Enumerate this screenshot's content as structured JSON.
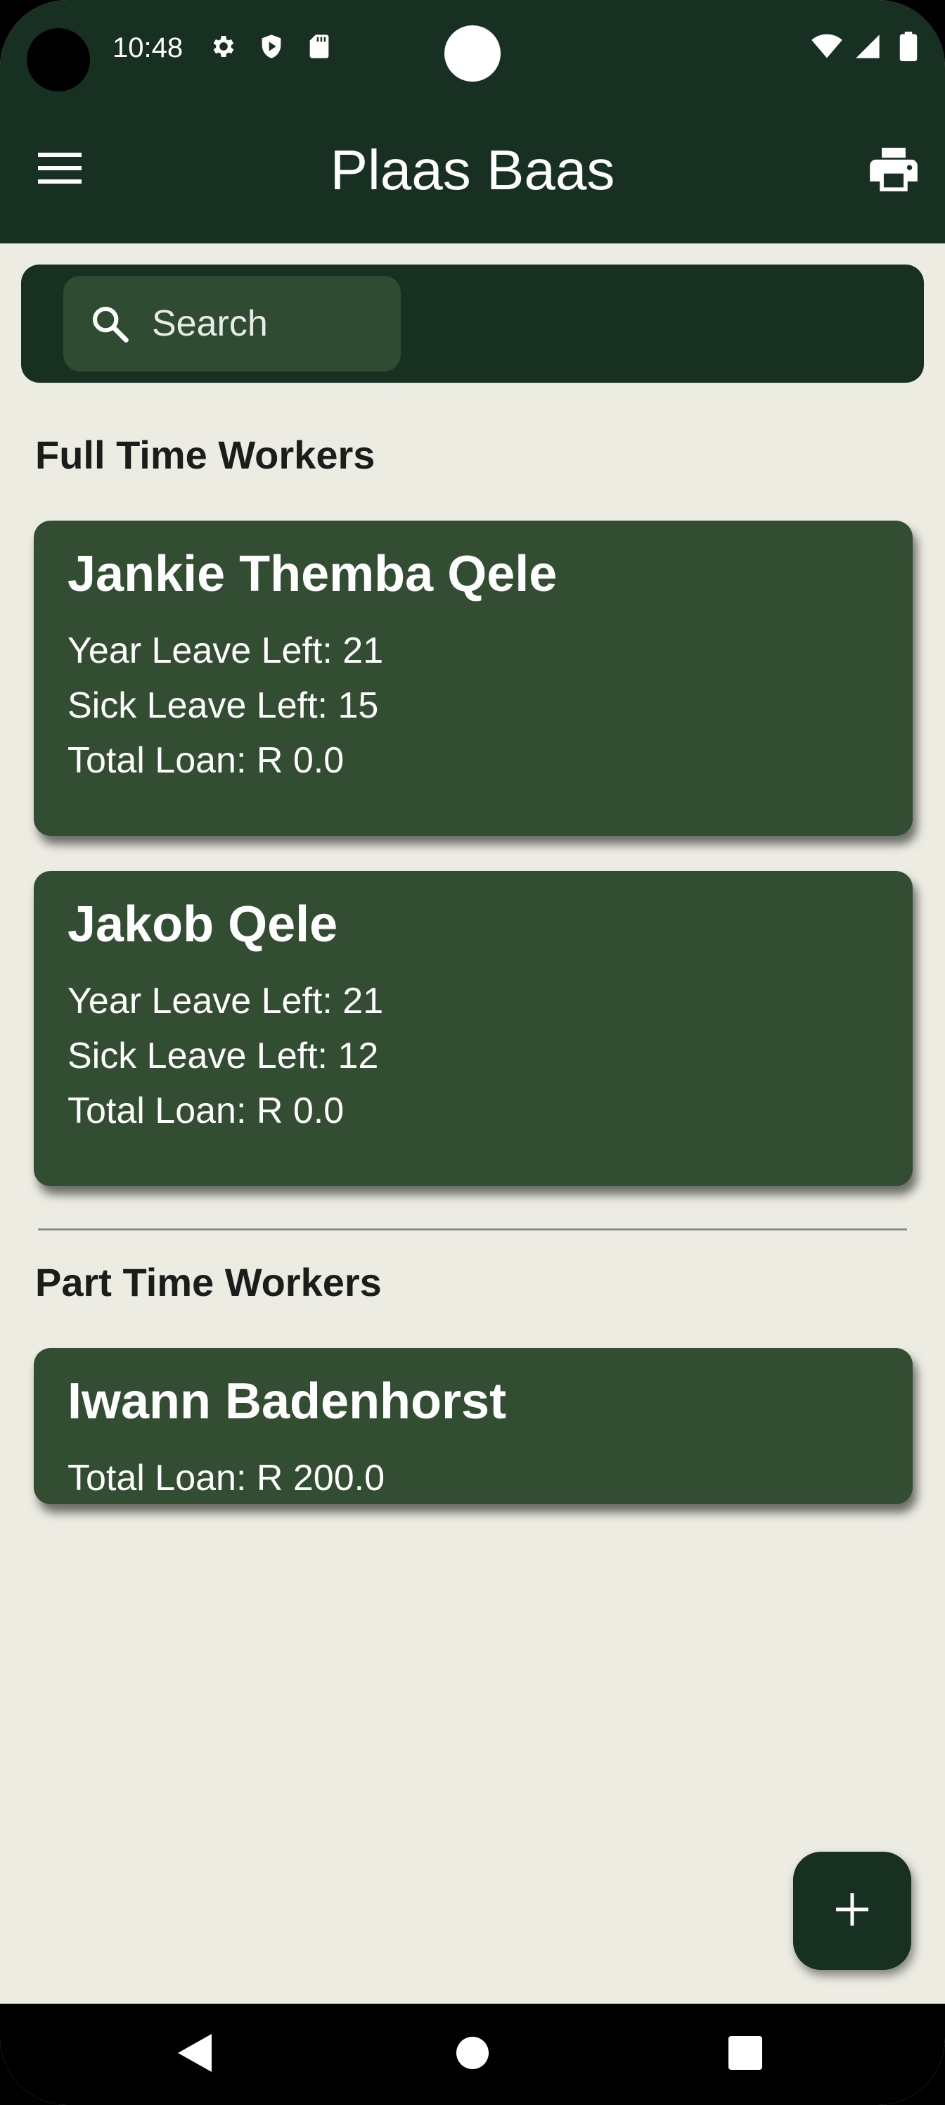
{
  "status_bar": {
    "time": "10:48",
    "left_icons": [
      "gear-icon",
      "shield-play-icon",
      "sd-card-icon"
    ],
    "right_icons": [
      "wifi-icon",
      "signal-icon",
      "battery-icon"
    ]
  },
  "app_bar": {
    "title": "Plaas Baas",
    "menu_icon": "menu-icon",
    "print_icon": "print-icon"
  },
  "search": {
    "placeholder": "Search",
    "icon": "search-icon"
  },
  "sections": {
    "full_time": {
      "title": "Full Time Workers",
      "workers": [
        {
          "name": "Jankie Themba Qele",
          "year_leave": "Year Leave Left: 21",
          "sick_leave": "Sick Leave Left: 15",
          "loan": "Total Loan: R 0.0"
        },
        {
          "name": "Jakob Qele",
          "year_leave": "Year Leave Left: 21",
          "sick_leave": "Sick Leave Left: 12",
          "loan": "Total Loan: R 0.0"
        }
      ]
    },
    "part_time": {
      "title": "Part Time Workers",
      "workers": [
        {
          "name": "Iwann Badenhorst",
          "loan": "Total Loan: R 200.0"
        }
      ]
    }
  },
  "fab": {
    "icon": "plus-icon"
  },
  "nav": {
    "icons": [
      "back-icon",
      "home-icon",
      "recents-icon"
    ]
  },
  "colors": {
    "app_bar": "#183021",
    "card": "#324d31",
    "background": "#ecece3",
    "search_pill": "#2f4b32"
  }
}
